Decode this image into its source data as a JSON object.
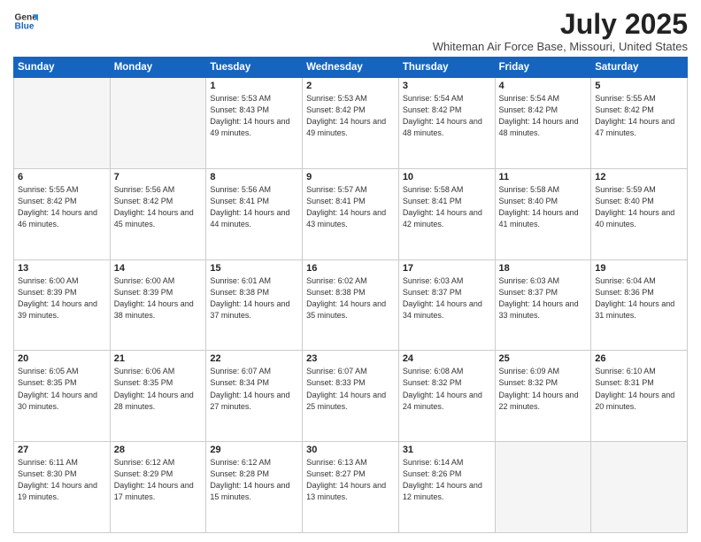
{
  "header": {
    "logo_line1": "General",
    "logo_line2": "Blue",
    "main_title": "July 2025",
    "subtitle": "Whiteman Air Force Base, Missouri, United States"
  },
  "calendar": {
    "weekdays": [
      "Sunday",
      "Monday",
      "Tuesday",
      "Wednesday",
      "Thursday",
      "Friday",
      "Saturday"
    ],
    "weeks": [
      [
        {
          "day": "",
          "empty": true
        },
        {
          "day": "",
          "empty": true
        },
        {
          "day": "1",
          "sunrise": "Sunrise: 5:53 AM",
          "sunset": "Sunset: 8:43 PM",
          "daylight": "Daylight: 14 hours and 49 minutes."
        },
        {
          "day": "2",
          "sunrise": "Sunrise: 5:53 AM",
          "sunset": "Sunset: 8:42 PM",
          "daylight": "Daylight: 14 hours and 49 minutes."
        },
        {
          "day": "3",
          "sunrise": "Sunrise: 5:54 AM",
          "sunset": "Sunset: 8:42 PM",
          "daylight": "Daylight: 14 hours and 48 minutes."
        },
        {
          "day": "4",
          "sunrise": "Sunrise: 5:54 AM",
          "sunset": "Sunset: 8:42 PM",
          "daylight": "Daylight: 14 hours and 48 minutes."
        },
        {
          "day": "5",
          "sunrise": "Sunrise: 5:55 AM",
          "sunset": "Sunset: 8:42 PM",
          "daylight": "Daylight: 14 hours and 47 minutes."
        }
      ],
      [
        {
          "day": "6",
          "sunrise": "Sunrise: 5:55 AM",
          "sunset": "Sunset: 8:42 PM",
          "daylight": "Daylight: 14 hours and 46 minutes."
        },
        {
          "day": "7",
          "sunrise": "Sunrise: 5:56 AM",
          "sunset": "Sunset: 8:42 PM",
          "daylight": "Daylight: 14 hours and 45 minutes."
        },
        {
          "day": "8",
          "sunrise": "Sunrise: 5:56 AM",
          "sunset": "Sunset: 8:41 PM",
          "daylight": "Daylight: 14 hours and 44 minutes."
        },
        {
          "day": "9",
          "sunrise": "Sunrise: 5:57 AM",
          "sunset": "Sunset: 8:41 PM",
          "daylight": "Daylight: 14 hours and 43 minutes."
        },
        {
          "day": "10",
          "sunrise": "Sunrise: 5:58 AM",
          "sunset": "Sunset: 8:41 PM",
          "daylight": "Daylight: 14 hours and 42 minutes."
        },
        {
          "day": "11",
          "sunrise": "Sunrise: 5:58 AM",
          "sunset": "Sunset: 8:40 PM",
          "daylight": "Daylight: 14 hours and 41 minutes."
        },
        {
          "day": "12",
          "sunrise": "Sunrise: 5:59 AM",
          "sunset": "Sunset: 8:40 PM",
          "daylight": "Daylight: 14 hours and 40 minutes."
        }
      ],
      [
        {
          "day": "13",
          "sunrise": "Sunrise: 6:00 AM",
          "sunset": "Sunset: 8:39 PM",
          "daylight": "Daylight: 14 hours and 39 minutes."
        },
        {
          "day": "14",
          "sunrise": "Sunrise: 6:00 AM",
          "sunset": "Sunset: 8:39 PM",
          "daylight": "Daylight: 14 hours and 38 minutes."
        },
        {
          "day": "15",
          "sunrise": "Sunrise: 6:01 AM",
          "sunset": "Sunset: 8:38 PM",
          "daylight": "Daylight: 14 hours and 37 minutes."
        },
        {
          "day": "16",
          "sunrise": "Sunrise: 6:02 AM",
          "sunset": "Sunset: 8:38 PM",
          "daylight": "Daylight: 14 hours and 35 minutes."
        },
        {
          "day": "17",
          "sunrise": "Sunrise: 6:03 AM",
          "sunset": "Sunset: 8:37 PM",
          "daylight": "Daylight: 14 hours and 34 minutes."
        },
        {
          "day": "18",
          "sunrise": "Sunrise: 6:03 AM",
          "sunset": "Sunset: 8:37 PM",
          "daylight": "Daylight: 14 hours and 33 minutes."
        },
        {
          "day": "19",
          "sunrise": "Sunrise: 6:04 AM",
          "sunset": "Sunset: 8:36 PM",
          "daylight": "Daylight: 14 hours and 31 minutes."
        }
      ],
      [
        {
          "day": "20",
          "sunrise": "Sunrise: 6:05 AM",
          "sunset": "Sunset: 8:35 PM",
          "daylight": "Daylight: 14 hours and 30 minutes."
        },
        {
          "day": "21",
          "sunrise": "Sunrise: 6:06 AM",
          "sunset": "Sunset: 8:35 PM",
          "daylight": "Daylight: 14 hours and 28 minutes."
        },
        {
          "day": "22",
          "sunrise": "Sunrise: 6:07 AM",
          "sunset": "Sunset: 8:34 PM",
          "daylight": "Daylight: 14 hours and 27 minutes."
        },
        {
          "day": "23",
          "sunrise": "Sunrise: 6:07 AM",
          "sunset": "Sunset: 8:33 PM",
          "daylight": "Daylight: 14 hours and 25 minutes."
        },
        {
          "day": "24",
          "sunrise": "Sunrise: 6:08 AM",
          "sunset": "Sunset: 8:32 PM",
          "daylight": "Daylight: 14 hours and 24 minutes."
        },
        {
          "day": "25",
          "sunrise": "Sunrise: 6:09 AM",
          "sunset": "Sunset: 8:32 PM",
          "daylight": "Daylight: 14 hours and 22 minutes."
        },
        {
          "day": "26",
          "sunrise": "Sunrise: 6:10 AM",
          "sunset": "Sunset: 8:31 PM",
          "daylight": "Daylight: 14 hours and 20 minutes."
        }
      ],
      [
        {
          "day": "27",
          "sunrise": "Sunrise: 6:11 AM",
          "sunset": "Sunset: 8:30 PM",
          "daylight": "Daylight: 14 hours and 19 minutes."
        },
        {
          "day": "28",
          "sunrise": "Sunrise: 6:12 AM",
          "sunset": "Sunset: 8:29 PM",
          "daylight": "Daylight: 14 hours and 17 minutes."
        },
        {
          "day": "29",
          "sunrise": "Sunrise: 6:12 AM",
          "sunset": "Sunset: 8:28 PM",
          "daylight": "Daylight: 14 hours and 15 minutes."
        },
        {
          "day": "30",
          "sunrise": "Sunrise: 6:13 AM",
          "sunset": "Sunset: 8:27 PM",
          "daylight": "Daylight: 14 hours and 13 minutes."
        },
        {
          "day": "31",
          "sunrise": "Sunrise: 6:14 AM",
          "sunset": "Sunset: 8:26 PM",
          "daylight": "Daylight: 14 hours and 12 minutes."
        },
        {
          "day": "",
          "empty": true
        },
        {
          "day": "",
          "empty": true
        }
      ]
    ]
  }
}
